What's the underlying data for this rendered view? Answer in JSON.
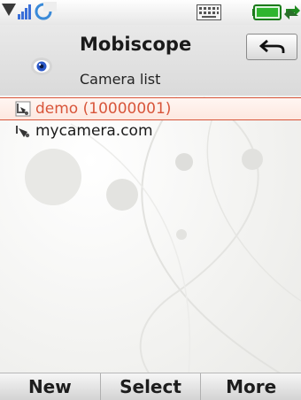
{
  "header": {
    "title": "Mobiscope",
    "subtitle": "Camera list",
    "app_icon": "eye-icon",
    "back_icon": "back-arrow-icon"
  },
  "status_bar": {
    "icons": [
      "signal-icon",
      "data-connection-icon",
      "keyboard-icon",
      "battery-icon",
      "sync-icon"
    ]
  },
  "cameras": [
    {
      "label": "demo (10000001)",
      "icon": "webcam-icon",
      "selected": true
    },
    {
      "label": "mycamera.com",
      "icon": "webcam-icon",
      "selected": false
    }
  ],
  "softkeys": {
    "left": "New",
    "center": "Select",
    "right": "More"
  },
  "colors": {
    "selected_text": "#d8553a",
    "text": "#1a1a1a",
    "battery_green": "#2fb52f",
    "signal_blue": "#3a6fd8"
  }
}
